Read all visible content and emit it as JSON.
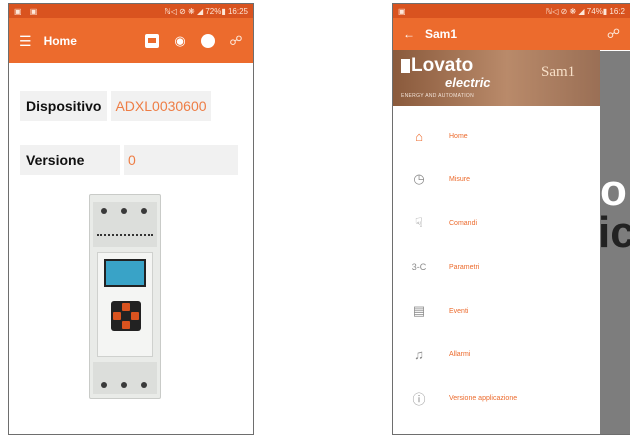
{
  "left_phone": {
    "status": {
      "left": "▣ ▣",
      "right": "ℕ◁ ⊘ ❋ ◢ 72%▮ 16:25"
    },
    "appbar": {
      "title": "Home"
    },
    "fields": [
      {
        "label": "Dispositivo",
        "value": "ADXL0030600"
      },
      {
        "label": "Versione",
        "value": "0"
      }
    ]
  },
  "right_phone": {
    "status": {
      "left": "▣",
      "right": "ℕ◁ ⊘ ❋ ◢ 74%▮ 16:2"
    },
    "appbar": {
      "title": "Sam1"
    },
    "drawer": {
      "brand": "Lovato",
      "brand_sub": "electric",
      "tagline": "ENERGY AND AUTOMATION",
      "product": "Sam1",
      "items": [
        {
          "label": "Home",
          "icon": "home-icon"
        },
        {
          "label": "Misure",
          "icon": "measure-icon"
        },
        {
          "label": "Comandi",
          "icon": "hand-pointer-icon"
        },
        {
          "label": "Parametri",
          "icon": "parameters-icon"
        },
        {
          "label": "Eventi",
          "icon": "events-icon"
        },
        {
          "label": "Allarmi",
          "icon": "alarm-bell-icon"
        },
        {
          "label": "Versione applicazione",
          "icon": "info-icon"
        }
      ]
    },
    "behind_text": {
      "line1": "o",
      "line2": "ic"
    }
  },
  "colors": {
    "accent": "#ec6b2d",
    "statusbar": "#d9531f",
    "value_text": "#ee7d45"
  }
}
